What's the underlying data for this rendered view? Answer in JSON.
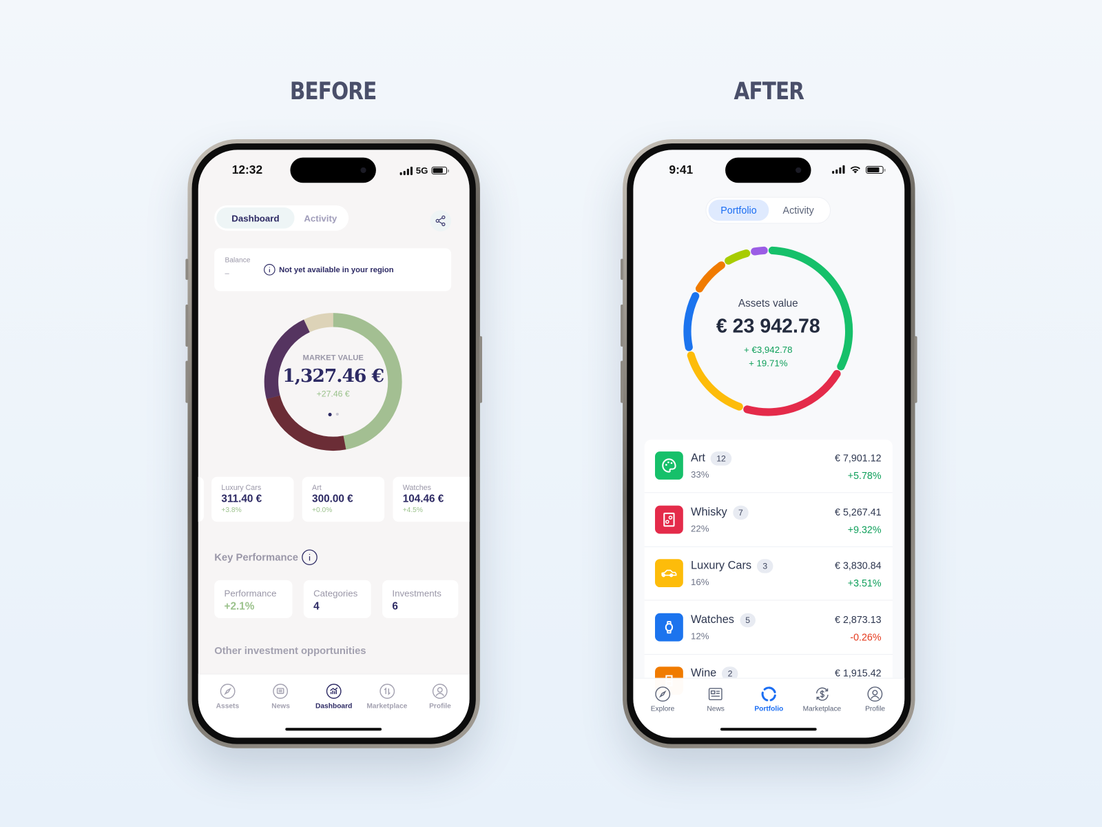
{
  "headings": {
    "before": "BEFORE",
    "after": "AFTER"
  },
  "before": {
    "status": {
      "time": "12:32",
      "network": "5G"
    },
    "tabs": [
      {
        "label": "Dashboard",
        "active": true
      },
      {
        "label": "Activity",
        "active": false
      }
    ],
    "share_icon": "share-icon",
    "balance": {
      "label": "Balance",
      "value": "–",
      "notice": "Not yet available in your region"
    },
    "market": {
      "label": "MARKET VALUE",
      "value": "1,327.46 €",
      "change": "+27.46 €",
      "page": 1,
      "pages": 2
    },
    "donut": [
      {
        "color": "#a3bf92",
        "percent": 47
      },
      {
        "color": "#6b2d36",
        "percent": 24
      },
      {
        "color": "#553460",
        "percent": 22
      },
      {
        "color": "#ddd3b8",
        "percent": 7
      }
    ],
    "assets": [
      {
        "name": "Luxury Cars",
        "value": "311.40 €",
        "change": "+3.8%"
      },
      {
        "name": "Art",
        "value": "300.00 €",
        "change": "+0.0%"
      },
      {
        "name": "Watches",
        "value": "104.46 €",
        "change": "+4.5%"
      }
    ],
    "key_performance": {
      "title": "Key Performance",
      "items": [
        {
          "label": "Performance",
          "value": "+2.1%"
        },
        {
          "label": "Categories",
          "value": "4"
        },
        {
          "label": "Investments",
          "value": "6"
        }
      ]
    },
    "other_title": "Other investment opportunities",
    "nav": [
      {
        "label": "Assets",
        "icon": "compass-icon"
      },
      {
        "label": "News",
        "icon": "news-icon"
      },
      {
        "label": "Dashboard",
        "icon": "chart-icon",
        "active": true
      },
      {
        "label": "Marketplace",
        "icon": "arrows-icon"
      },
      {
        "label": "Profile",
        "icon": "profile-icon"
      }
    ],
    "colors": {
      "navy": "#2d2a64",
      "green": "#9bc28c"
    }
  },
  "after": {
    "status": {
      "time": "9:41"
    },
    "tabs": [
      {
        "label": "Portfolio",
        "active": true
      },
      {
        "label": "Activity",
        "active": false
      }
    ],
    "summary": {
      "label": "Assets value",
      "value": "€ 23 942.78",
      "change_abs": "+ €3,942.78",
      "change_pct": "+ 19.71%"
    },
    "donut": [
      {
        "color": "#16c06a",
        "percent": 33
      },
      {
        "color": "#e42b4a",
        "percent": 22
      },
      {
        "color": "#fdbc0a",
        "percent": 16
      },
      {
        "color": "#1c74ee",
        "percent": 12
      },
      {
        "color": "#f07b00",
        "percent": 8
      },
      {
        "color": "#a8cc00",
        "percent": 5.5
      },
      {
        "color": "#9b5de5",
        "percent": 3.5
      }
    ],
    "assets": [
      {
        "name": "Art",
        "count": "12",
        "share": "33%",
        "value": "€ 7,901.12",
        "change": "+5.78%",
        "color": "#16c06a",
        "icon": "palette-icon",
        "positive": true
      },
      {
        "name": "Whisky",
        "count": "7",
        "share": "22%",
        "value": "€ 5,267.41",
        "change": "+9.32%",
        "color": "#e42b4a",
        "icon": "whisky-icon",
        "positive": true
      },
      {
        "name": "Luxury Cars",
        "count": "3",
        "share": "16%",
        "value": "€ 3,830.84",
        "change": "+3.51%",
        "color": "#fdbc0a",
        "icon": "car-icon",
        "positive": true
      },
      {
        "name": "Watches",
        "count": "5",
        "share": "12%",
        "value": "€ 2,873.13",
        "change": "-0.26%",
        "color": "#1c74ee",
        "icon": "watch-icon",
        "positive": false
      },
      {
        "name": "Wine",
        "count": "2",
        "share": "",
        "value": "€ 1,915.42",
        "change": "",
        "color": "#f07b00",
        "icon": "wine-icon",
        "positive": true
      }
    ],
    "nav": [
      {
        "label": "Explore",
        "icon": "compass-icon"
      },
      {
        "label": "News",
        "icon": "news-icon"
      },
      {
        "label": "Portfolio",
        "icon": "portfolio-icon",
        "active": true
      },
      {
        "label": "Marketplace",
        "icon": "exchange-icon"
      },
      {
        "label": "Profile",
        "icon": "profile-icon"
      }
    ],
    "colors": {
      "accent": "#1b6ef3",
      "positive": "#0e9f5a",
      "negative": "#e5391d"
    }
  }
}
